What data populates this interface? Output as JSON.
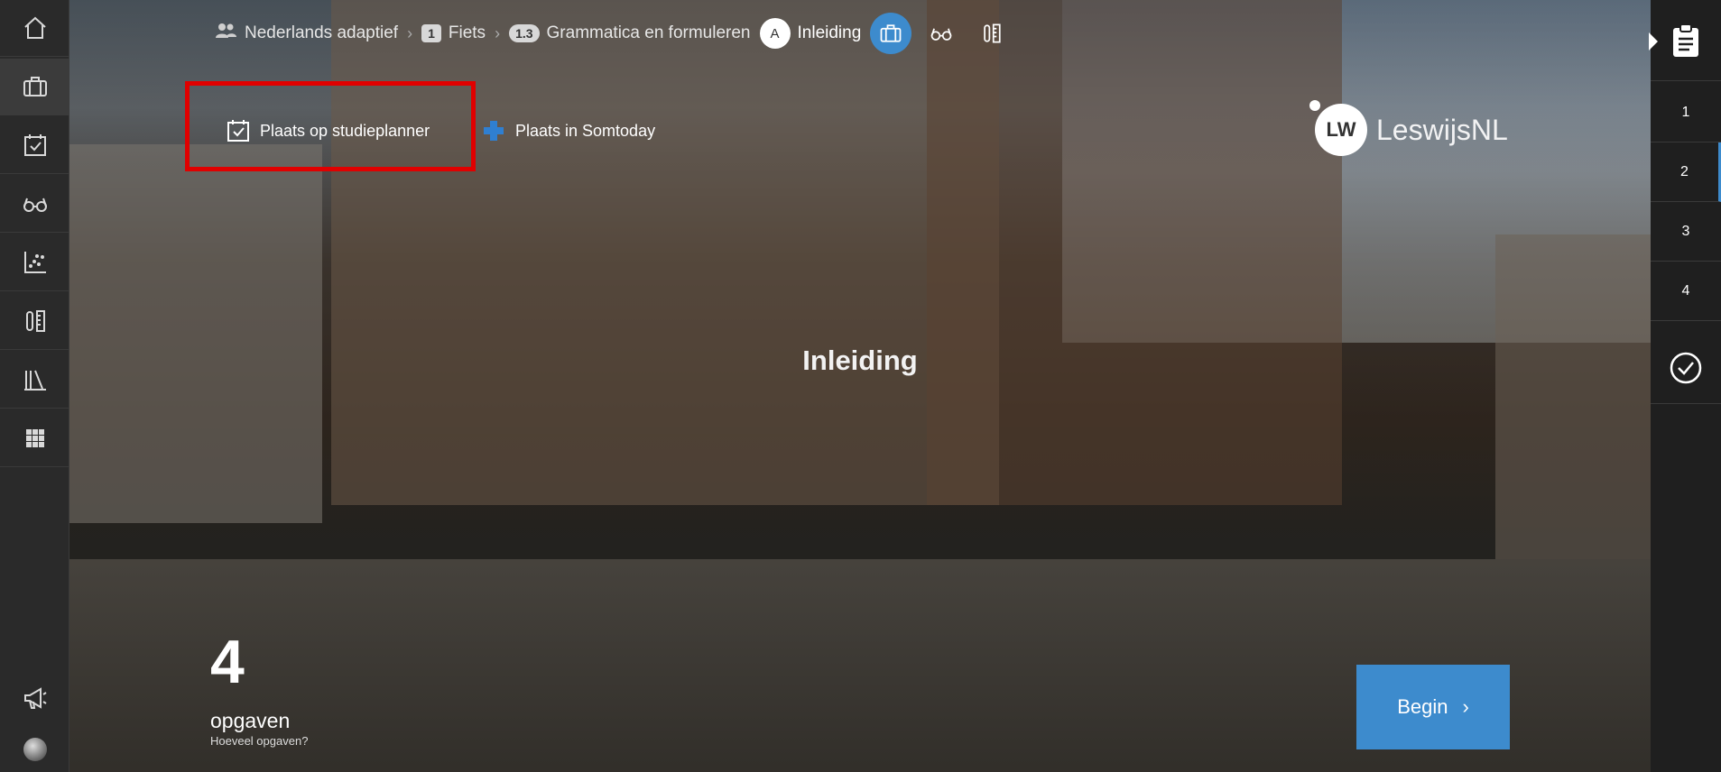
{
  "breadcrumb": {
    "items": [
      {
        "label": "Nederlands adaptief"
      },
      {
        "badge": "1",
        "label": "Fiets"
      },
      {
        "badge": "1.3",
        "label": "Grammatica en formuleren"
      },
      {
        "badge": "A",
        "label": "Inleiding"
      }
    ]
  },
  "actions": {
    "planner_label": "Plaats op studieplanner",
    "somtoday_label": "Plaats in Somtoday"
  },
  "logo": {
    "mark": "LW",
    "name": "Leswijs",
    "suffix": "NL"
  },
  "main": {
    "title": "Inleiding"
  },
  "exercises": {
    "count": "4",
    "label": "opgaven",
    "question": "Hoeveel opgaven?"
  },
  "begin_label": "Begin",
  "steps": [
    "1",
    "2",
    "3",
    "4"
  ],
  "colors": {
    "accent": "#3d8bcd",
    "highlight": "#e00000",
    "rail": "#2a2a2a"
  },
  "left_rail_icons": [
    "home-icon",
    "briefcase-icon",
    "calendar-check-icon",
    "glasses-icon",
    "scatter-chart-icon",
    "tools-icon",
    "library-icon",
    "apps-grid-icon"
  ]
}
